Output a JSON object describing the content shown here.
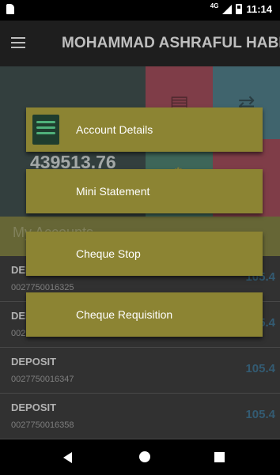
{
  "app": {
    "title": "MOHAMMAD ASHRAFUL HABIB"
  },
  "status": {
    "network": "4G",
    "time": "11:14"
  },
  "hero": {
    "balance": "439513.76"
  },
  "my_accounts_label": "My Accounts",
  "accounts": [
    {
      "type": "DEPOSIT",
      "number": "0027750016325",
      "amount": "105.4"
    },
    {
      "type": "DEPOSIT",
      "number": "0027750016336",
      "amount": "105.4"
    },
    {
      "type": "DEPOSIT",
      "number": "0027750016347",
      "amount": "105.4"
    },
    {
      "type": "DEPOSIT",
      "number": "0027750016358",
      "amount": "105.4"
    }
  ],
  "menu": {
    "items": [
      {
        "label": "Account Details",
        "icon": "ledger-icon"
      },
      {
        "label": "Mini Statement"
      },
      {
        "label": "Cheque Stop"
      },
      {
        "label": "Cheque Requisition"
      }
    ]
  },
  "colors": {
    "accent": "#8c8433",
    "appbar": "#252525",
    "amount": "#3f6f8c"
  }
}
